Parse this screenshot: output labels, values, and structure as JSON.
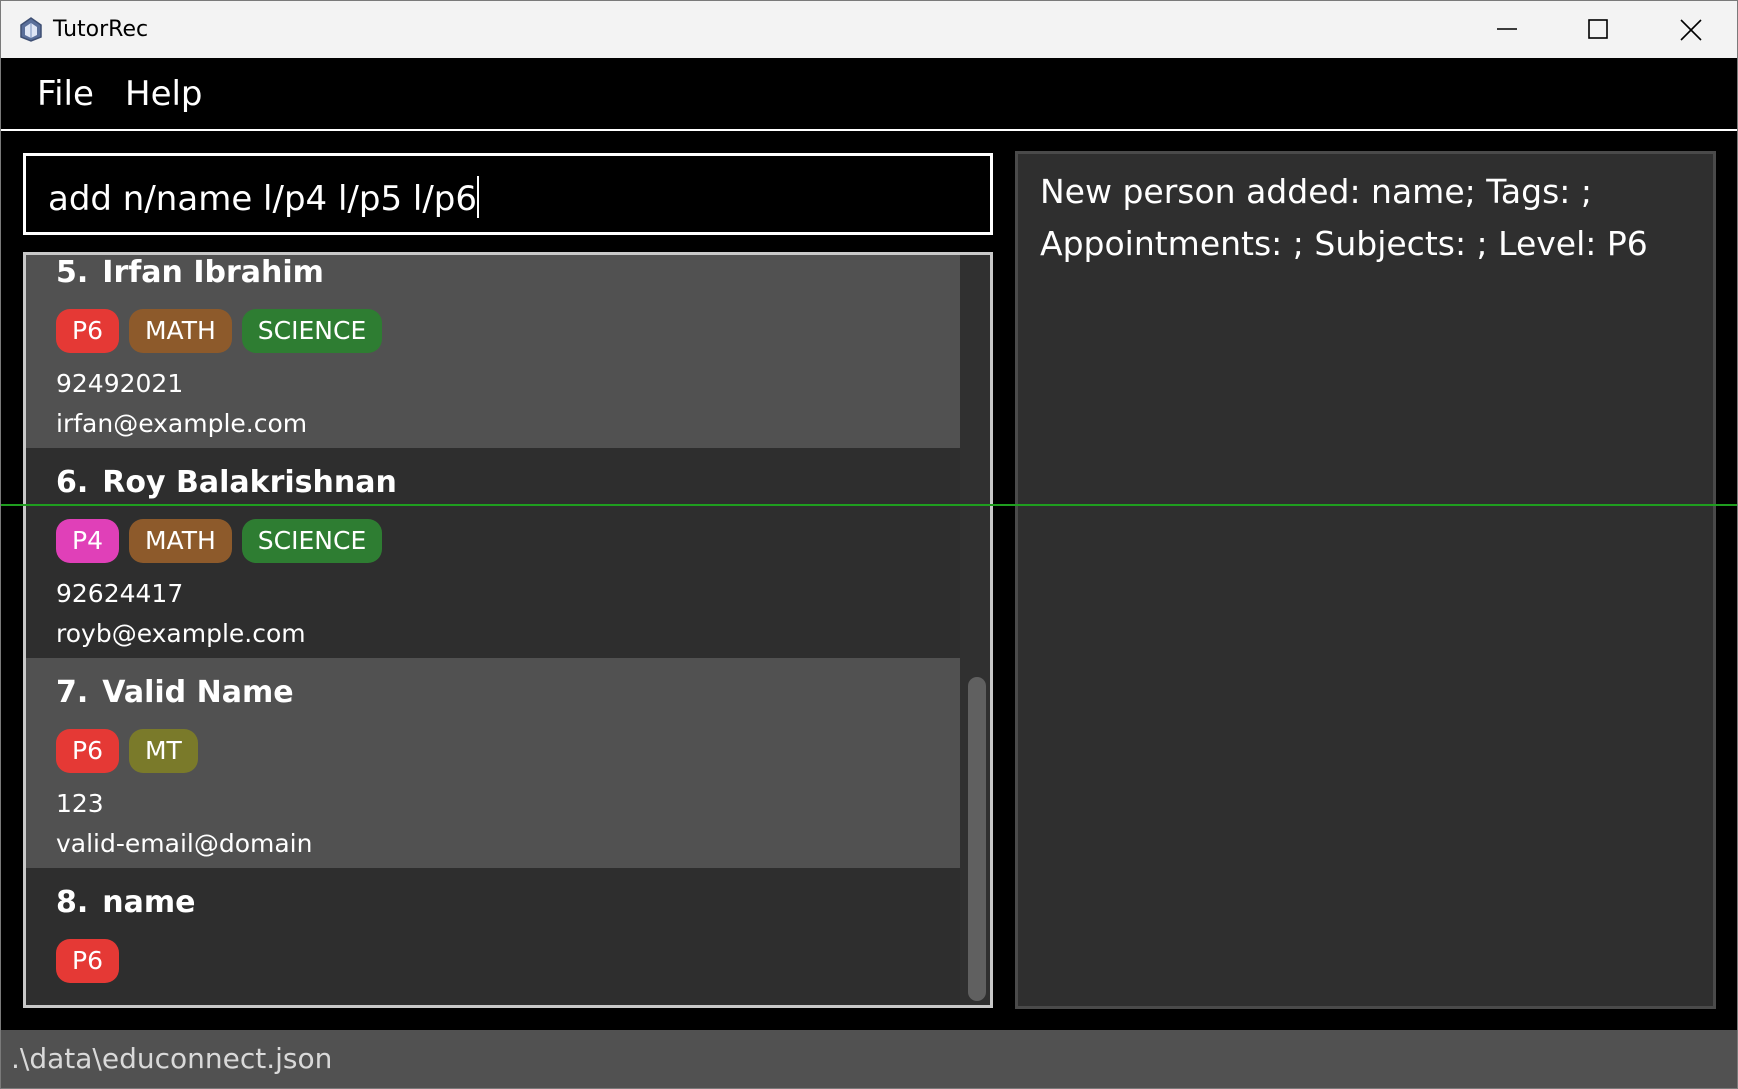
{
  "window": {
    "title": "TutorRec"
  },
  "menu": {
    "items": [
      "File",
      "Help"
    ]
  },
  "command": {
    "value": "add n/name l/p4 l/p5 l/p6"
  },
  "result": {
    "lines": [
      "New person added: name; Tags: ;",
      "Appointments: ; Subjects: ; Level: P6"
    ]
  },
  "persons": [
    {
      "index": "5.",
      "name": "Irfan Ibrahim",
      "tags": [
        {
          "label": "P6",
          "color": "#e53935"
        },
        {
          "label": "MATH",
          "color": "#8d5a2b"
        },
        {
          "label": "SCIENCE",
          "color": "#2e7d32"
        }
      ],
      "phone": "92492021",
      "email": "irfan@example.com"
    },
    {
      "index": "6.",
      "name": "Roy Balakrishnan",
      "tags": [
        {
          "label": "P4",
          "color": "#e040b8"
        },
        {
          "label": "MATH",
          "color": "#8d5a2b"
        },
        {
          "label": "SCIENCE",
          "color": "#2e7d32"
        }
      ],
      "phone": "92624417",
      "email": "royb@example.com"
    },
    {
      "index": "7.",
      "name": "Valid Name",
      "tags": [
        {
          "label": "P6",
          "color": "#e53935"
        },
        {
          "label": "MT",
          "color": "#7a7a2a"
        }
      ],
      "phone": "123",
      "email": "valid-email@domain"
    },
    {
      "index": "8.",
      "name": "name",
      "tags": [
        {
          "label": "P6",
          "color": "#e53935"
        }
      ],
      "phone": "-",
      "email": "-"
    }
  ],
  "status": {
    "path": ".\\data\\educonnect.json"
  },
  "icons": {
    "app": "app-logo-icon",
    "minimize": "minimize-icon",
    "maximize": "maximize-icon",
    "close": "close-icon"
  }
}
